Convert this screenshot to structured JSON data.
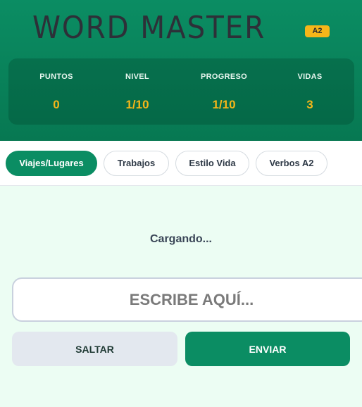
{
  "header": {
    "title": "WORD MASTER",
    "level_badge": "A2"
  },
  "stats": [
    {
      "label": "PUNTOS",
      "value": "0"
    },
    {
      "label": "NIVEL",
      "value": "1/10"
    },
    {
      "label": "PROGRESO",
      "value": "1/10"
    },
    {
      "label": "VIDAS",
      "value": "3"
    }
  ],
  "tabs": [
    {
      "label": "Viajes/Lugares",
      "active": true
    },
    {
      "label": "Trabajos",
      "active": false
    },
    {
      "label": "Estilo Vida",
      "active": false
    },
    {
      "label": "Verbos A2",
      "active": false
    }
  ],
  "status_text": "Cargando...",
  "answer": {
    "placeholder": "ESCRIBE AQUÍ...",
    "value": ""
  },
  "buttons": {
    "skip_label": "SALTAR",
    "send_label": "ENVIAR"
  },
  "colors": {
    "primary": "#0b8d63",
    "accent": "#f5b619",
    "background": "#ecfdf3"
  }
}
